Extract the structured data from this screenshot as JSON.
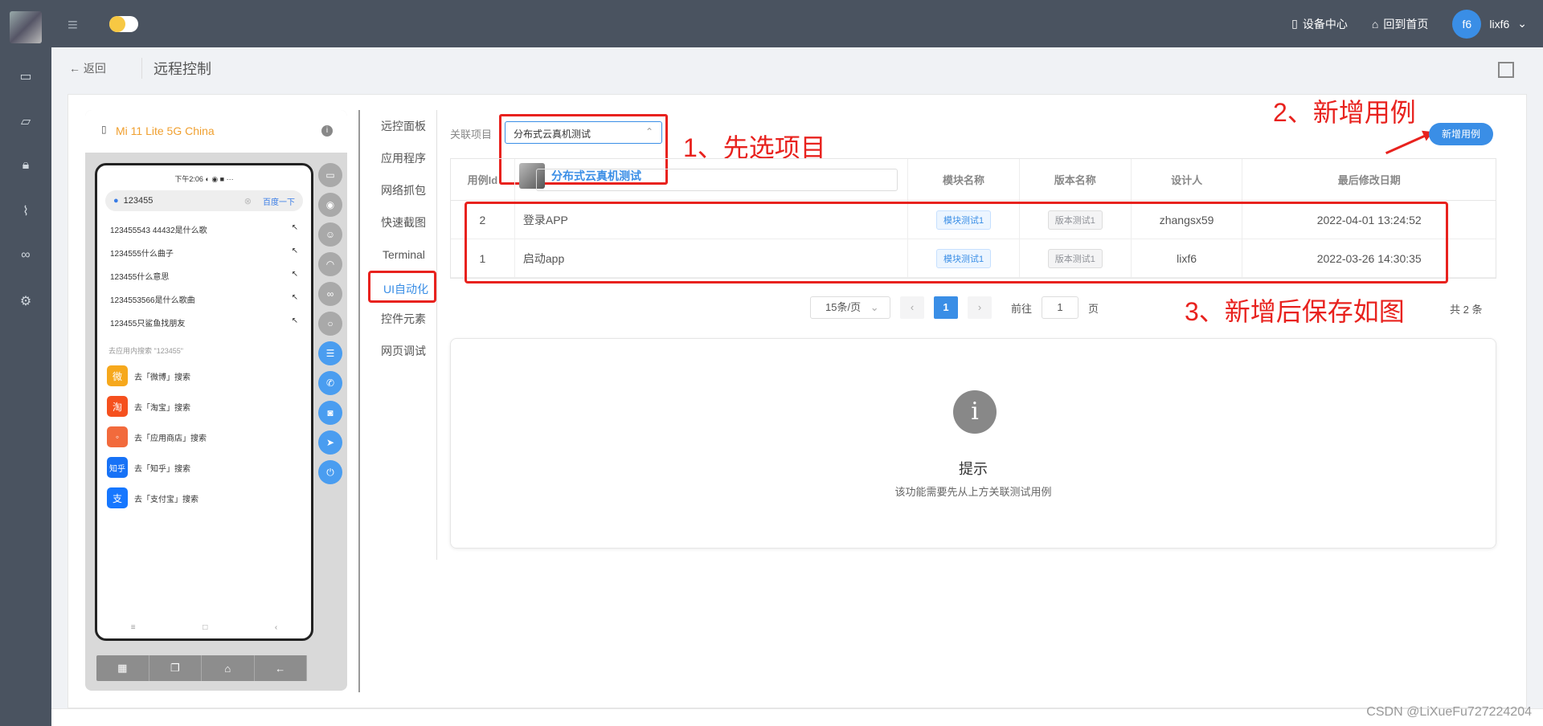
{
  "topbar": {
    "device_center": "设备中心",
    "home": "回到首页",
    "avatar_text": "f6",
    "username": "lixf6"
  },
  "header": {
    "back_label": "← 返回",
    "title": "远程控制"
  },
  "phone": {
    "device_name": "Mi 11 Lite 5G China",
    "status_text": "下午2:06 ◐ ◉ ■ ···",
    "search_query": "123455",
    "search_go": "百度一下",
    "suggestions": [
      "123455543 44432是什么歌",
      "1234555什么曲子",
      "123455什么意思",
      "1234553566是什么歌曲",
      "123455只鲨鱼找朋友"
    ],
    "in_app_search_heading": "去应用内搜索 \"123455\"",
    "app_searches": [
      {
        "icon": "weibo-icon",
        "label": "去「微博」搜索",
        "color": "#f6a81c",
        "glyph": "微"
      },
      {
        "icon": "taobao-icon",
        "label": "去「淘宝」搜索",
        "color": "#f5501e",
        "glyph": "淘"
      },
      {
        "icon": "app-store-icon",
        "label": "去「应用商店」搜索",
        "color": "#f26a3c",
        "glyph": "◦"
      },
      {
        "icon": "zhihu-icon",
        "label": "去「知乎」搜索",
        "color": "#1772f6",
        "glyph": "知乎"
      },
      {
        "icon": "alipay-icon",
        "label": "去「支付宝」搜索",
        "color": "#1677ff",
        "glyph": "支"
      }
    ]
  },
  "tabs": [
    "远控面板",
    "应用程序",
    "网络抓包",
    "快速截图",
    "Terminal",
    "UI自动化",
    "控件元素",
    "网页调试"
  ],
  "main": {
    "relate_label": "关联项目",
    "selected_project": "分布式云真机测试",
    "dropdown_option": "分布式云真机测试",
    "new_case_button": "新增用例",
    "annotation1": "1、先选项目",
    "annotation2": "2、新增用例",
    "annotation3": "3、新增后保存如图",
    "columns": [
      "用例Id",
      "",
      "模块名称",
      "版本名称",
      "设计人",
      "最后修改日期"
    ],
    "rows": [
      {
        "id": "2",
        "name": "登录APP",
        "module": "模块测试1",
        "version": "版本测试1",
        "designer": "zhangsx59",
        "date": "2022-04-01 13:24:52"
      },
      {
        "id": "1",
        "name": "启动app",
        "module": "模块测试1",
        "version": "版本测试1",
        "designer": "lixf6",
        "date": "2022-03-26 14:30:35"
      }
    ],
    "pagination": {
      "page_size": "15条/页",
      "current_page": "1",
      "goto_label": "前往",
      "goto_value": "1",
      "page_unit": "页",
      "total": "共 2 条"
    },
    "hint_title": "提示",
    "hint_desc": "该功能需要先从上方关联测试用例"
  },
  "watermark": "CSDN @LiXueFu727224204",
  "colors": {
    "accent": "#3a8ee6",
    "annotation_red": "#e8221e",
    "topbar": "#4a5360"
  }
}
